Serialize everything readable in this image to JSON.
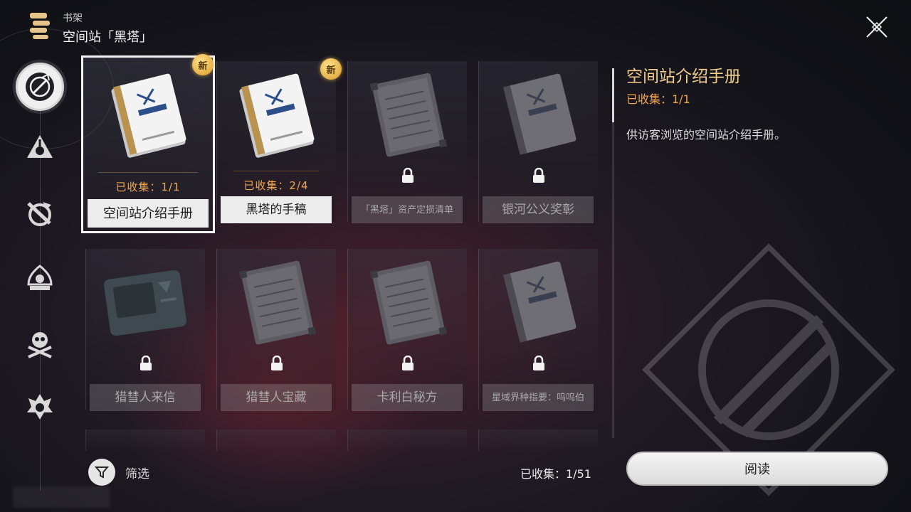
{
  "header": {
    "section": "书架",
    "title": "空间站「黑塔」"
  },
  "sidebar": {
    "items": [
      {
        "icon": "compass-emblem-icon",
        "active": true
      },
      {
        "icon": "triangle-crest-icon"
      },
      {
        "icon": "dragon-crest-icon"
      },
      {
        "icon": "shrine-crest-icon"
      },
      {
        "icon": "skull-crest-icon"
      },
      {
        "icon": "flame-crest-icon"
      }
    ]
  },
  "grid": {
    "items": [
      {
        "name": "空间站介绍手册",
        "collected": "已收集：1/1",
        "locked": false,
        "new": true,
        "selected": true,
        "kind": "manual"
      },
      {
        "name": "黑塔的手稿",
        "collected": "已收集：2/4",
        "locked": false,
        "new": true,
        "kind": "manual"
      },
      {
        "name": "「黑塔」资产定损清单",
        "locked": true,
        "kind": "notebook"
      },
      {
        "name": "银河公义奖彰",
        "locked": true,
        "kind": "manual-dark"
      },
      {
        "name": "猎彗人来信",
        "locked": true,
        "kind": "tablet"
      },
      {
        "name": "猎彗人宝藏",
        "locked": true,
        "kind": "notebook"
      },
      {
        "name": "卡利白秘方",
        "locked": true,
        "kind": "notebook"
      },
      {
        "name": "星域界种指要：呜呜伯",
        "locked": true,
        "kind": "manual-dark"
      }
    ],
    "new_badge": "新"
  },
  "detail": {
    "title": "空间站介绍手册",
    "collected": "已收集：1/1",
    "description": "供访客浏览的空间站介绍手册。"
  },
  "footer": {
    "filter_label": "筛选",
    "total": "已收集：1/51",
    "read_button": "阅读"
  },
  "colors": {
    "accent": "#f0a44e",
    "title_gold": "#f1cd8e"
  }
}
